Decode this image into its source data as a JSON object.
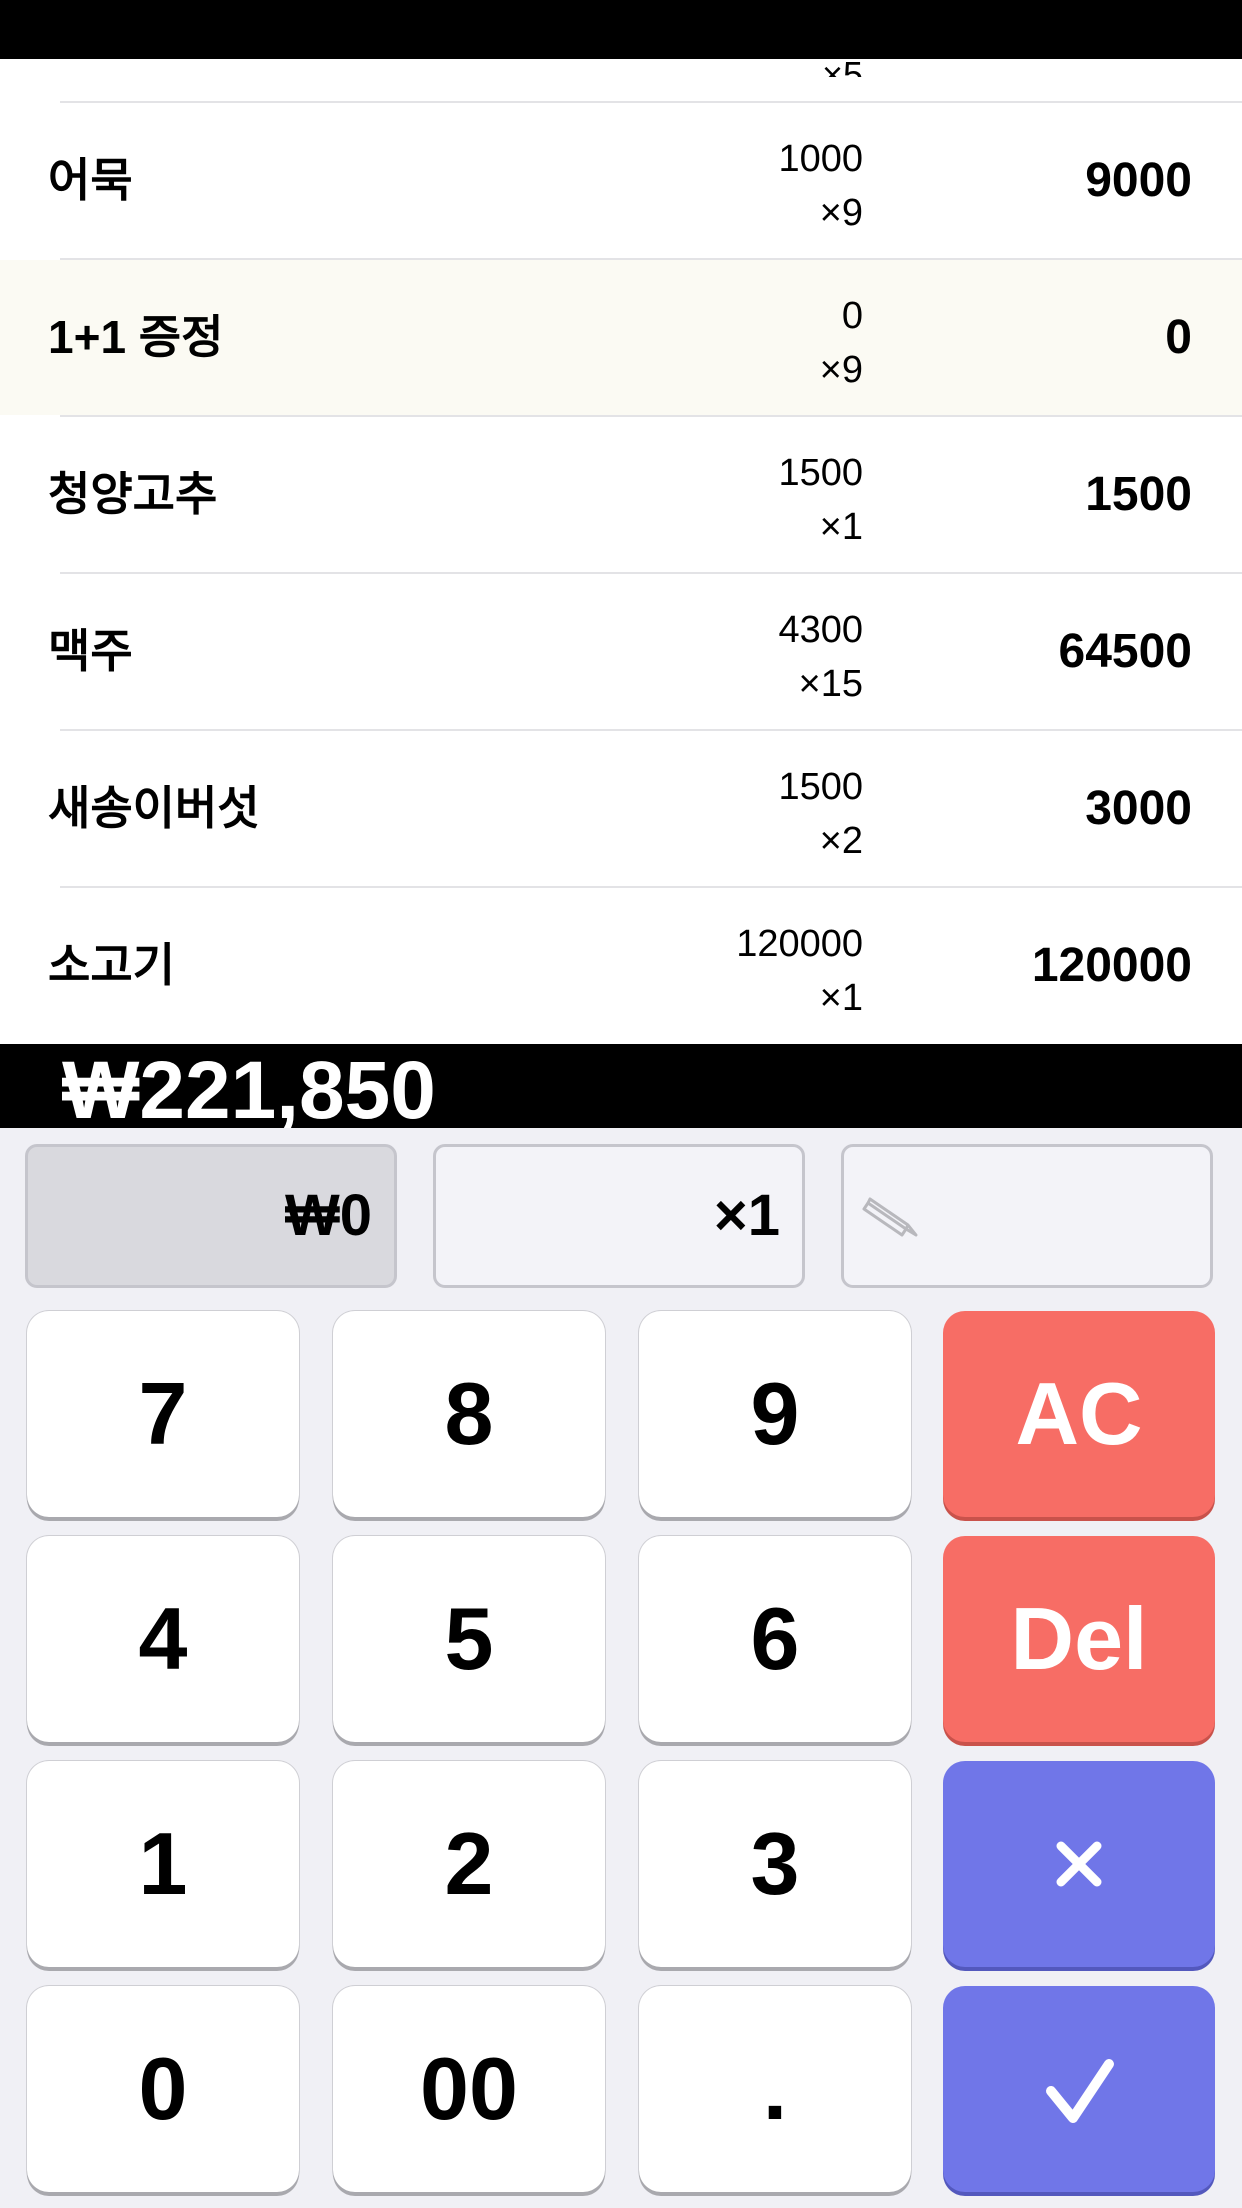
{
  "status_bar": {},
  "list": {
    "partial_top_qty": "×5",
    "items": [
      {
        "name": "어묵",
        "unit_price": "1000",
        "qty": "×9",
        "total": "9000"
      },
      {
        "name": "1+1 증정",
        "unit_price": "0",
        "qty": "×9",
        "total": "0",
        "highlighted": true
      },
      {
        "name": "청양고추",
        "unit_price": "1500",
        "qty": "×1",
        "total": "1500"
      },
      {
        "name": "맥주",
        "unit_price": "4300",
        "qty": "×15",
        "total": "64500"
      },
      {
        "name": "새송이버섯",
        "unit_price": "1500",
        "qty": "×2",
        "total": "3000"
      },
      {
        "name": "소고기",
        "unit_price": "120000",
        "qty": "×1",
        "total": "120000"
      }
    ]
  },
  "grand_total": "₩221,850",
  "input": {
    "price": "₩0",
    "multiplier": "×1",
    "note_icon": "pencil-icon"
  },
  "keypad": {
    "k7": "7",
    "k8": "8",
    "k9": "9",
    "ac": "AC",
    "k4": "4",
    "k5": "5",
    "k6": "6",
    "del": "Del",
    "k1": "1",
    "k2": "2",
    "k3": "3",
    "multiply_icon": "multiply-icon",
    "k0": "0",
    "k00": "00",
    "dot": ".",
    "confirm_icon": "checkmark-icon"
  },
  "colors": {
    "highlight_row": "#fbfaf3",
    "red_key": "#f76d65",
    "blue_key": "#7076e8",
    "total_bar": "#000000"
  }
}
